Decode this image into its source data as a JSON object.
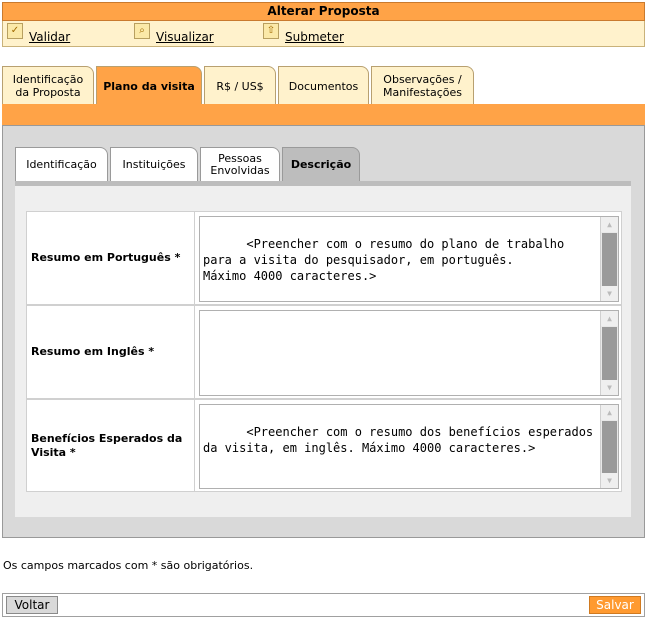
{
  "header": {
    "title": "Alterar Proposta"
  },
  "toolbar": {
    "validar": {
      "label": "Validar",
      "icon": "check-icon"
    },
    "visualizar": {
      "label": "Visualizar",
      "icon": "magnifier-icon"
    },
    "submeter": {
      "label": "Submeter",
      "icon": "submit-icon"
    }
  },
  "main_tabs": [
    {
      "line1": "Identificação",
      "line2": "da Proposta"
    },
    {
      "line1": "Plano da visita",
      "line2": ""
    },
    {
      "line1": "R$ / US$",
      "line2": ""
    },
    {
      "line1": "Documentos",
      "line2": ""
    },
    {
      "line1": "Observações /",
      "line2": "Manifestações"
    }
  ],
  "sub_tabs": [
    {
      "line1": "Identificação",
      "line2": ""
    },
    {
      "line1": "Instituições",
      "line2": ""
    },
    {
      "line1": "Pessoas",
      "line2": "Envolvidas"
    },
    {
      "line1": "Descrição",
      "line2": ""
    }
  ],
  "form": {
    "resumo_pt": {
      "label": "Resumo em Português *",
      "value": "<Preencher com o resumo do plano de trabalho\npara a visita do pesquisador, em português.\nMáximo 4000 caracteres.>"
    },
    "resumo_en": {
      "label": "Resumo em Inglês  *",
      "value": ""
    },
    "beneficios": {
      "label": "Benefícios Esperados da Visita *",
      "value": "<Preencher com o resumo dos benefícios esperados\nda visita, em inglês. Máximo 4000 caracteres.>"
    }
  },
  "note": "Os campos marcados com * são obrigatórios.",
  "buttons": {
    "voltar": "Voltar",
    "salvar": "Salvar"
  },
  "colors": {
    "accent": "#ffa347",
    "toolbar_bg": "#fff2cc",
    "panel_grey": "#d9d9d9",
    "active_subtab": "#bdbdbd",
    "save_button": "#ff9a30"
  }
}
